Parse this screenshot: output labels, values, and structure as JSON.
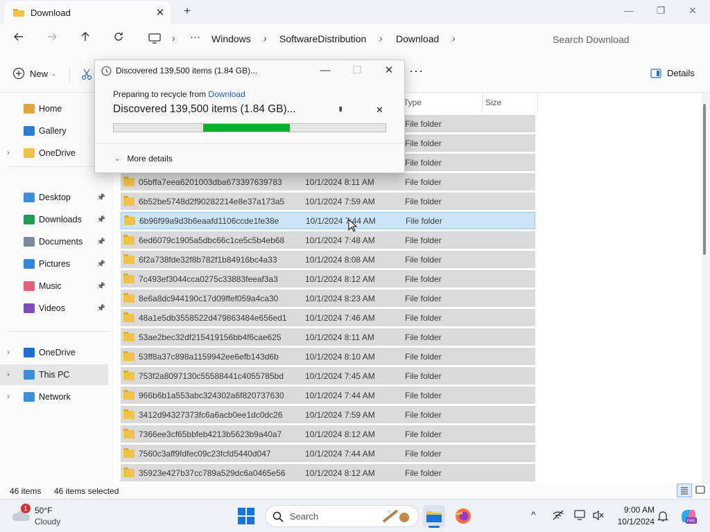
{
  "window": {
    "tab_title": "Download",
    "tab_close": "✕",
    "new_tab": "+",
    "minimize": "—",
    "maximize": "❐",
    "close": "✕"
  },
  "nav": {
    "breadcrumbs": [
      "Windows",
      "SoftwareDistribution",
      "Download"
    ],
    "search_placeholder": "Search Download",
    "more": "···"
  },
  "toolbar": {
    "new_label": "New",
    "details_label": "Details",
    "more": "···"
  },
  "sidebar": {
    "groups": [
      [
        {
          "label": "Home",
          "icon": "home-icon",
          "color": "#e2a53c"
        },
        {
          "label": "Gallery",
          "icon": "gallery-icon",
          "color": "#2b7cd3"
        },
        {
          "label": "OneDrive",
          "icon": "folder-icon",
          "color": "#f2c246",
          "expand": "›"
        }
      ],
      [
        {
          "label": "Desktop",
          "icon": "desktop-icon",
          "color": "#3a8fd8",
          "pin": true
        },
        {
          "label": "Downloads",
          "icon": "download-icon",
          "color": "#1e9e55",
          "pin": true
        },
        {
          "label": "Documents",
          "icon": "documents-icon",
          "color": "#7a8a9c",
          "pin": true
        },
        {
          "label": "Pictures",
          "icon": "pictures-icon",
          "color": "#2f88d9",
          "pin": true
        },
        {
          "label": "Music",
          "icon": "music-icon",
          "color": "#e0607a",
          "pin": true
        },
        {
          "label": "Videos",
          "icon": "videos-icon",
          "color": "#7c4dbd",
          "pin": true
        }
      ],
      [
        {
          "label": "OneDrive",
          "icon": "cloud-icon",
          "color": "#1b6fd1",
          "expand": "›"
        },
        {
          "label": "This PC",
          "icon": "pc-icon",
          "color": "#3a8fd8",
          "expand": "›",
          "selected": true
        },
        {
          "label": "Network",
          "icon": "network-icon",
          "color": "#3a8fd8",
          "expand": "›"
        }
      ]
    ]
  },
  "list": {
    "headers": {
      "type": "Type",
      "size": "Size"
    },
    "partial_rows": [
      {
        "type": "File folder"
      },
      {
        "type": "File folder"
      },
      {
        "type": "File folder"
      }
    ],
    "rows": [
      {
        "name": "05bffa7eea6201003dba673397639783",
        "date": "10/1/2024 8:11 AM",
        "type": "File folder"
      },
      {
        "name": "6b52be5748d2f90282214e8e37a173a5",
        "date": "10/1/2024 7:59 AM",
        "type": "File folder"
      },
      {
        "name": "6b96f99a9d3b6eaafd1106ccde1fe38e",
        "date": "10/1/2024 7:44 AM",
        "type": "File folder",
        "selected": true
      },
      {
        "name": "6ed6079c1905a5dbc66c1ce5c5b4eb68",
        "date": "10/1/2024 7:48 AM",
        "type": "File folder"
      },
      {
        "name": "6f2a738fde32f8b782f1b84916bc4a33",
        "date": "10/1/2024 8:08 AM",
        "type": "File folder"
      },
      {
        "name": "7c493ef3044cca0275c33883feeaf3a3",
        "date": "10/1/2024 8:12 AM",
        "type": "File folder"
      },
      {
        "name": "8e6a8dc944190c17d09ffef059a4ca30",
        "date": "10/1/2024 8:23 AM",
        "type": "File folder"
      },
      {
        "name": "48a1e5db3558522d479863484e656ed1",
        "date": "10/1/2024 7:46 AM",
        "type": "File folder"
      },
      {
        "name": "53ae2bec32df215419156bb4f6cae625",
        "date": "10/1/2024 8:11 AM",
        "type": "File folder"
      },
      {
        "name": "53ff8a37c898a1159942ee6efb143d6b",
        "date": "10/1/2024 8:10 AM",
        "type": "File folder"
      },
      {
        "name": "753f2a8097130c55588441c4055785bd",
        "date": "10/1/2024 7:45 AM",
        "type": "File folder"
      },
      {
        "name": "966b6b1a553abc324302a6f820737630",
        "date": "10/1/2024 7:44 AM",
        "type": "File folder"
      },
      {
        "name": "3412d94327373fc6a6acb0ee1dc0dc26",
        "date": "10/1/2024 7:59 AM",
        "type": "File folder"
      },
      {
        "name": "7366ee3cf65bbfeb4213b5623b9a40a7",
        "date": "10/1/2024 8:12 AM",
        "type": "File folder"
      },
      {
        "name": "7560c3aff9fdfec09c23fcfd5440d047",
        "date": "10/1/2024 7:44 AM",
        "type": "File folder"
      },
      {
        "name": "35923e427b37cc789a529dc6a0465e56",
        "date": "10/1/2024 8:12 AM",
        "type": "File folder"
      }
    ]
  },
  "status": {
    "items": "46 items",
    "selected": "46 items selected"
  },
  "dialog": {
    "title": "Discovered 139,500 items (1.84 GB)...",
    "preparing_prefix": "Preparing to recycle from",
    "preparing_link": "Download",
    "heading": "Discovered 139,500 items (1.84 GB)...",
    "pause": "II",
    "cancel": "✕",
    "more_details": "More details",
    "progress_start_fraction": 0.33,
    "progress_end_fraction": 0.65,
    "progress_color": "#06b025",
    "minimize": "—",
    "maximize": "☐",
    "close": "✕"
  },
  "taskbar": {
    "weather_temp": "50°F",
    "weather_desc": "Cloudy",
    "weather_badge": "1",
    "search_label": "Search",
    "time": "9:00 AM",
    "date": "10/1/2024",
    "tray_chevron": "^"
  }
}
